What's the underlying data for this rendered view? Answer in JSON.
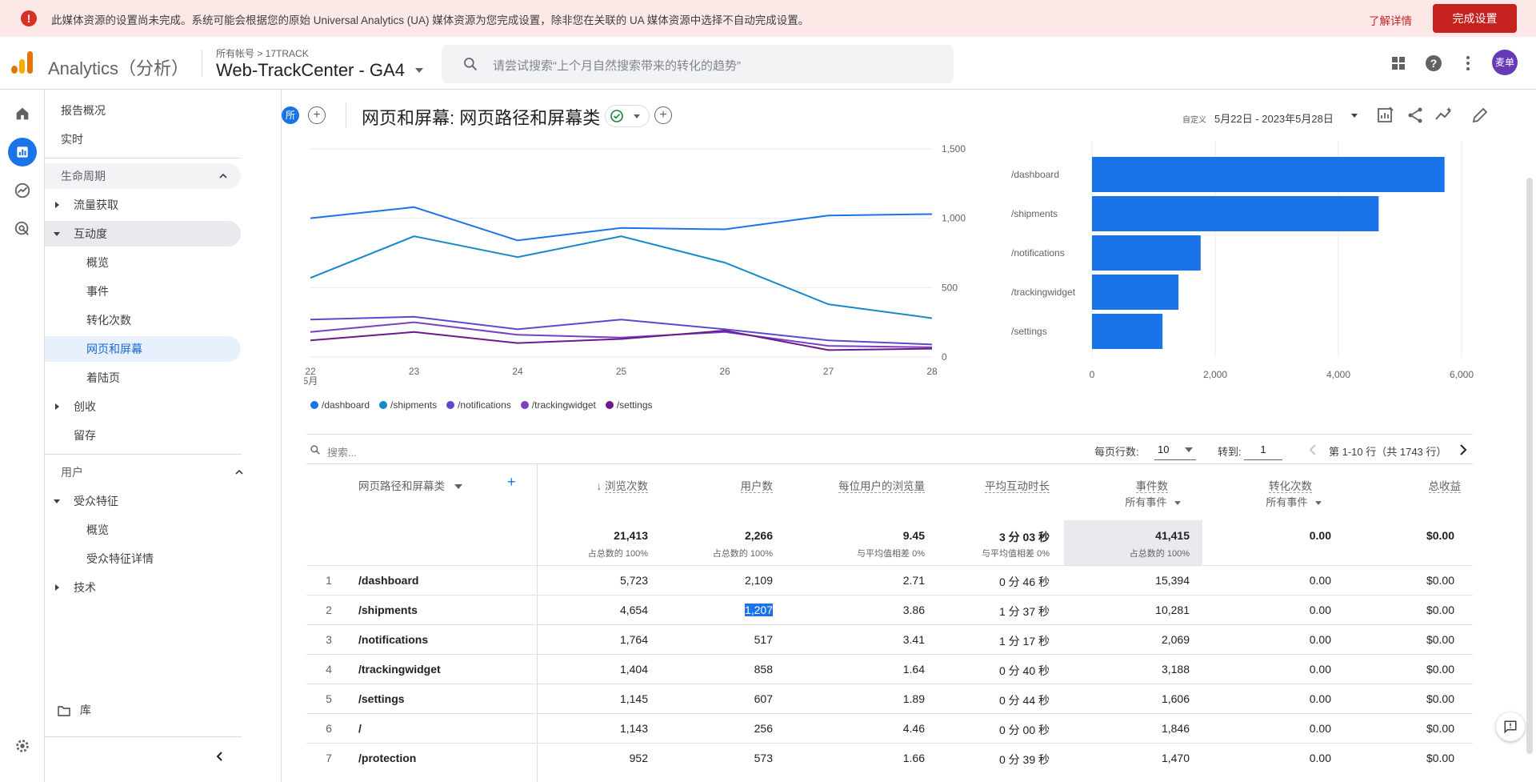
{
  "banner": {
    "text": "此媒体资源的设置尚未完成。系统可能会根据您的原始 Universal Analytics (UA) 媒体资源为您完成设置，除非您在关联的 UA 媒体资源中选择不自动完成设置。",
    "learn_more": "了解详情",
    "finish_button": "完成设置"
  },
  "header": {
    "brand": "Analytics（分析）",
    "breadcrumb": "所有帐号 > 17TRACK",
    "property": "Web-TrackCenter - GA4",
    "search_placeholder": "请尝试搜索“上个月自然搜索带来的转化的趋势”",
    "avatar": "麦单"
  },
  "nav": {
    "top_items": [
      "报告概况",
      "实时"
    ],
    "lifecycle": "生命周期",
    "acquisition": "流量获取",
    "engagement": "互动度",
    "engagement_sub": [
      "概览",
      "事件",
      "转化次数",
      "网页和屏幕",
      "着陆页"
    ],
    "monetization": "创收",
    "retention": "留存",
    "user": "用户",
    "user_attributes": "受众特征",
    "user_attributes_sub": [
      "概览",
      "受众特征详情"
    ],
    "tech": "技术",
    "library": "库"
  },
  "report": {
    "all_chip": "所",
    "title": "网页和屏幕: 网页路径和屏幕类",
    "date_label": "自定义",
    "date_range": "5月22日 - 2023年5月28日"
  },
  "colors": {
    "dashboard": "#1a73e8",
    "shipments": "#1589c9",
    "notifications": "#5c49d0",
    "trackingwidget": "#7b3fc4",
    "settings": "#6a1a8a"
  },
  "chart_data": [
    {
      "type": "line",
      "x": [
        "22",
        "23",
        "24",
        "25",
        "26",
        "27",
        "28"
      ],
      "x_sublabel": "5月",
      "ylim": [
        0,
        1500
      ],
      "yticks": [
        "0",
        "500",
        "1,000",
        "1,500"
      ],
      "series": [
        {
          "name": "/dashboard",
          "values": [
            1000,
            1080,
            840,
            930,
            920,
            1020,
            1030
          ]
        },
        {
          "name": "/shipments",
          "values": [
            570,
            870,
            720,
            870,
            680,
            380,
            280
          ]
        },
        {
          "name": "/notifications",
          "values": [
            270,
            290,
            200,
            270,
            200,
            120,
            90
          ]
        },
        {
          "name": "/trackingwidget",
          "values": [
            180,
            250,
            160,
            140,
            180,
            80,
            70
          ]
        },
        {
          "name": "/settings",
          "values": [
            120,
            180,
            100,
            130,
            190,
            50,
            60
          ]
        }
      ]
    },
    {
      "type": "bar",
      "orientation": "horizontal",
      "categories": [
        "/dashboard",
        "/shipments",
        "/notifications",
        "/trackingwidget",
        "/settings"
      ],
      "values": [
        5723,
        4654,
        1764,
        1404,
        1145
      ],
      "xlim": [
        0,
        6000
      ],
      "xticks": [
        "0",
        "2,000",
        "4,000",
        "6,000"
      ]
    }
  ],
  "table": {
    "search_placeholder": "搜索...",
    "rows_per_page_label": "每页行数:",
    "rows_per_page": "10",
    "goto_label": "转到:",
    "goto_value": "1",
    "page_info": "第 1-10 行（共 1743 行）",
    "dim_header": "网页路径和屏幕类",
    "headers": [
      "浏览次数",
      "用户数",
      "每位用户的浏览量",
      "平均互动时长",
      "事件数",
      "转化次数",
      "总收益"
    ],
    "event_sub": "所有事件",
    "conv_sub": "所有事件",
    "totals": [
      "21,413",
      "2,266",
      "9.45",
      "3 分 03 秒",
      "41,415",
      "0.00",
      "$0.00"
    ],
    "totals_sub": [
      "占总数的 100%",
      "占总数的 100%",
      "与平均值相差 0%",
      "与平均值相差 0%",
      "占总数的 100%",
      "",
      ""
    ],
    "rows": [
      {
        "idx": "1",
        "path": "/dashboard",
        "views": "5,723",
        "users": "2,109",
        "vpu": "2.71",
        "time": "0 分 46 秒",
        "events": "15,394",
        "conv": "0.00",
        "rev": "$0.00"
      },
      {
        "idx": "2",
        "path": "/shipments",
        "views": "4,654",
        "users": "1,207",
        "vpu": "3.86",
        "time": "1 分 37 秒",
        "events": "10,281",
        "conv": "0.00",
        "rev": "$0.00"
      },
      {
        "idx": "3",
        "path": "/notifications",
        "views": "1,764",
        "users": "517",
        "vpu": "3.41",
        "time": "1 分 17 秒",
        "events": "2,069",
        "conv": "0.00",
        "rev": "$0.00"
      },
      {
        "idx": "4",
        "path": "/trackingwidget",
        "views": "1,404",
        "users": "858",
        "vpu": "1.64",
        "time": "0 分 40 秒",
        "events": "3,188",
        "conv": "0.00",
        "rev": "$0.00"
      },
      {
        "idx": "5",
        "path": "/settings",
        "views": "1,145",
        "users": "607",
        "vpu": "1.89",
        "time": "0 分 44 秒",
        "events": "1,606",
        "conv": "0.00",
        "rev": "$0.00"
      },
      {
        "idx": "6",
        "path": "/",
        "views": "1,143",
        "users": "256",
        "vpu": "4.46",
        "time": "0 分 00 秒",
        "events": "1,846",
        "conv": "0.00",
        "rev": "$0.00"
      },
      {
        "idx": "7",
        "path": "/protection",
        "views": "952",
        "users": "573",
        "vpu": "1.66",
        "time": "0 分 39 秒",
        "events": "1,470",
        "conv": "0.00",
        "rev": "$0.00"
      }
    ]
  }
}
